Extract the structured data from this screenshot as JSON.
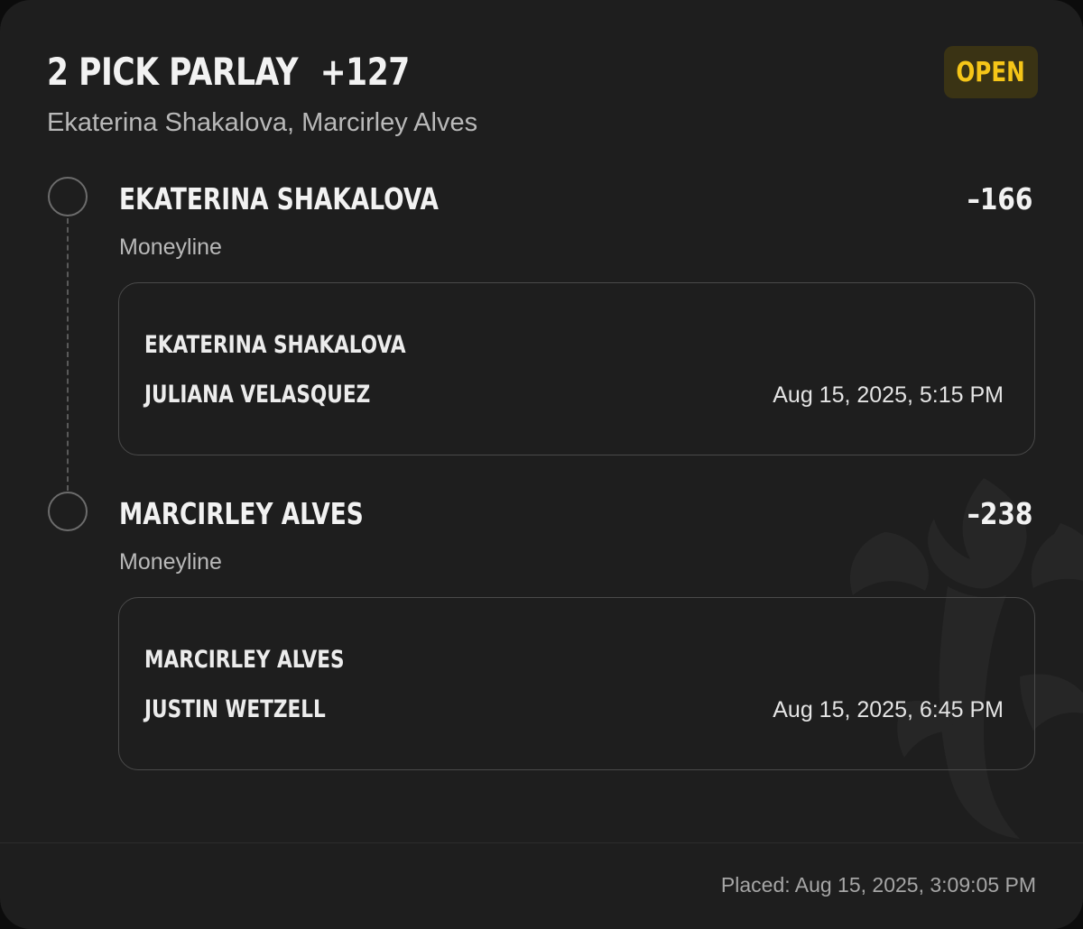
{
  "bet": {
    "title": "2 PICK PARLAY",
    "odds": "+127",
    "status": "OPEN",
    "subtitle": "Ekaterina Shakalova, Marcirley Alves",
    "placed": "Placed: Aug 15, 2025, 3:09:05 PM"
  },
  "legs": [
    {
      "selection": "EKATERINA SHAKALOVA",
      "odds": "–166",
      "market": "Moneyline",
      "event": {
        "team1": "EKATERINA SHAKALOVA",
        "team2": "JULIANA VELASQUEZ",
        "time": "Aug 15, 2025, 5:15 PM"
      }
    },
    {
      "selection": "MARCIRLEY ALVES",
      "odds": "–238",
      "market": "Moneyline",
      "event": {
        "team1": "MARCIRLEY ALVES",
        "team2": "JUSTIN WETZELL",
        "time": "Aug 15, 2025, 6:45 PM"
      }
    }
  ],
  "colors": {
    "card_background": "#1e1e1e",
    "status_text": "#f5c518",
    "status_background": "#3a3314"
  },
  "icons": {
    "leg_status": "empty-circle-icon",
    "watermark": "fleur-de-lis-watermark-icon"
  }
}
